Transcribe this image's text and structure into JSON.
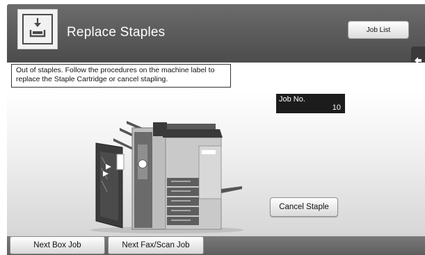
{
  "header": {
    "title": "Replace Staples",
    "job_list_label": "Job List",
    "staple_icon": "staple-replace-icon",
    "side_tab_icon": "arrow-left-icon"
  },
  "message": {
    "text": "Out of staples. Follow the procedures on the machine label to replace the Staple Cartridge or cancel stapling."
  },
  "job": {
    "label": "Job No.",
    "number": "10"
  },
  "actions": {
    "cancel_staple": "Cancel Staple"
  },
  "footer": {
    "next_box_job": "Next Box Job",
    "next_fax_scan_job": "Next Fax/Scan Job"
  },
  "illustration": {
    "icon": "mfp-machine-with-finisher-icon"
  },
  "colors": {
    "header": "#5a5a5a",
    "footer": "#6a6a6a",
    "job_panel": "#1c1c1c"
  }
}
